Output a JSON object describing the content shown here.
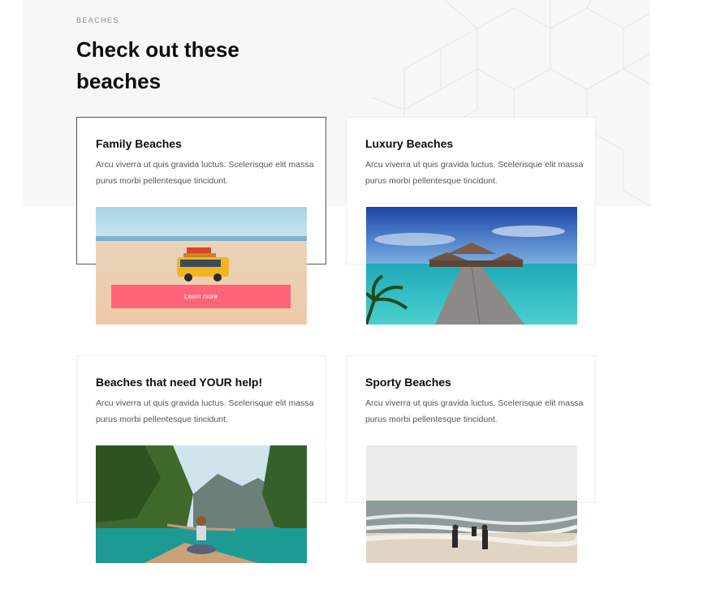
{
  "section": {
    "eyebrow": "BEACHES",
    "title": "Check out these beaches"
  },
  "cards": [
    {
      "title": "Family Beaches",
      "description": "Arcu viverra ut quis gravida luctus. Scelerisque elit massa purus morbi pellentesque tincidunt.",
      "button_label": "Learn more"
    },
    {
      "title": "Luxury Beaches",
      "description": "Arcu viverra ut quis gravida luctus. Scelerisque elit massa purus morbi pellentesque tincidunt."
    },
    {
      "title": "Beaches that need YOUR help!",
      "description": "Arcu viverra ut quis gravida luctus. Scelerisque elit massa purus morbi pellentesque tincidunt."
    },
    {
      "title": "Sporty Beaches",
      "description": "Arcu viverra ut quis gravida luctus. Scelerisque elit massa purus morbi pellentesque tincidunt."
    }
  ],
  "colors": {
    "accent": "#ff6479",
    "hero_bg": "#f7f7f7"
  }
}
